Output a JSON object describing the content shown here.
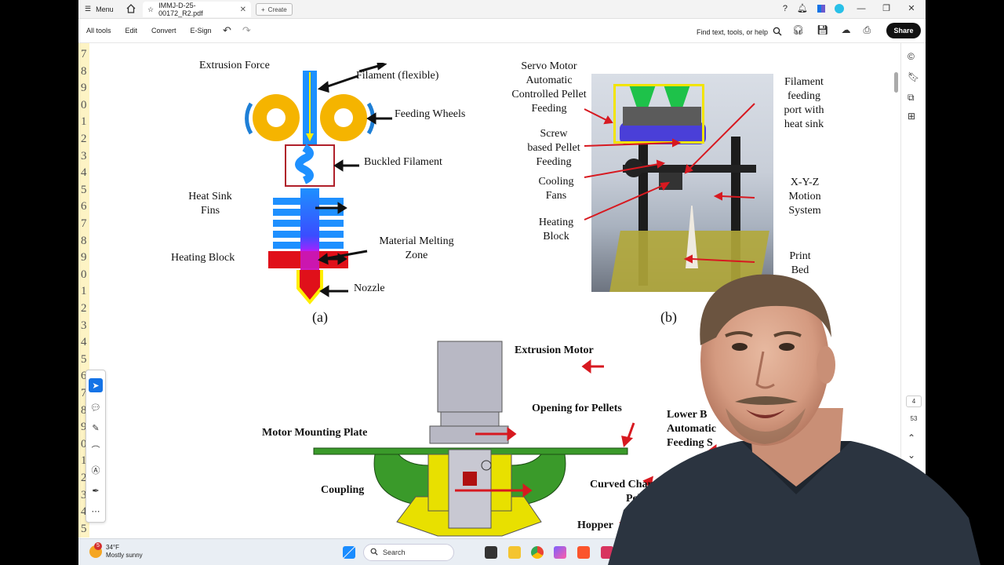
{
  "titlebar": {
    "menu_label": "Menu",
    "tab_title": "IMMJ-D-25-00172_R2.pdf",
    "create_label": "Create"
  },
  "toolbar": {
    "all_tools": "All tools",
    "edit": "Edit",
    "convert": "Convert",
    "esign": "E-Sign",
    "find_placeholder": "Find text, tools, or help",
    "share": "Share"
  },
  "line_numbers": [
    "7",
    "8",
    "9",
    "0",
    "1",
    "2",
    "3",
    "4",
    "5",
    "6",
    "7",
    "8",
    "9",
    "0",
    "1",
    "2",
    "3",
    "4",
    "5",
    "6",
    "7",
    "8",
    "9",
    "0",
    "1",
    "2",
    "3",
    "4",
    "5"
  ],
  "figure_a": {
    "extrusion_force": "Extrusion Force",
    "filament": "Filament (flexible)",
    "feeding_wheels": "Feeding Wheels",
    "buckled": "Buckled Filament",
    "heat_sink_1": "Heat Sink",
    "heat_sink_2": "Fins",
    "melting_1": "Material Melting",
    "melting_2": "Zone",
    "heating_block": "Heating Block",
    "nozzle": "Nozzle",
    "caption": "(a)"
  },
  "figure_b": {
    "servo_1": "Servo Motor",
    "servo_2": "Automatic",
    "servo_3": "Controlled Pellet",
    "servo_4": "Feeding",
    "screw_1": "Screw",
    "screw_2": "based Pellet",
    "screw_3": "Feeding",
    "cooling_1": "Cooling",
    "cooling_2": "Fans",
    "heating_1": "Heating",
    "heating_2": "Block",
    "port_1": "Filament",
    "port_2": "feeding",
    "port_3": "port with",
    "port_4": "heat sink",
    "xyz_1": "X-Y-Z",
    "xyz_2": "Motion",
    "xyz_3": "System",
    "bed_1": "Print",
    "bed_2": "Bed",
    "caption": "(b)"
  },
  "figure_c": {
    "extrusion_motor": "Extrusion Motor",
    "opening": "Opening for Pellets",
    "mounting_plate": "Motor Mounting Plate",
    "lower_1": "Lower B",
    "lower_2": "Automatic",
    "lower_3": "Feeding S",
    "coupling": "Coupling",
    "curved_1": "Curved Chann",
    "curved_2": "Pel",
    "hopper": "Hopper"
  },
  "rail": {
    "page_current": "4",
    "page_total": "53"
  },
  "taskbar": {
    "weather_badge": "5",
    "temperature": "34°F",
    "condition": "Mostly sunny",
    "search_label": "Search"
  },
  "colors": {
    "accent_blue": "#1473e6",
    "filament_blue": "#1e90ff",
    "wheel_yellow": "#f5b400",
    "heating_red": "#e0101a",
    "part_green": "#3a9a2a",
    "part_yellow": "#e8e000",
    "motor_gray": "#b8b8c4"
  },
  "icons": [
    "menu-icon",
    "home-icon",
    "star-icon",
    "close-icon",
    "plus-icon",
    "help-icon",
    "bell-icon",
    "apps-icon",
    "profile-icon",
    "minimize-icon",
    "restore-icon",
    "undo-icon",
    "redo-icon",
    "search-icon",
    "headphones-icon",
    "save-icon",
    "upload-icon",
    "print-icon",
    "select-icon",
    "comment-icon",
    "pen-icon",
    "lasso-icon",
    "text-icon",
    "sign-icon",
    "more-icon"
  ]
}
